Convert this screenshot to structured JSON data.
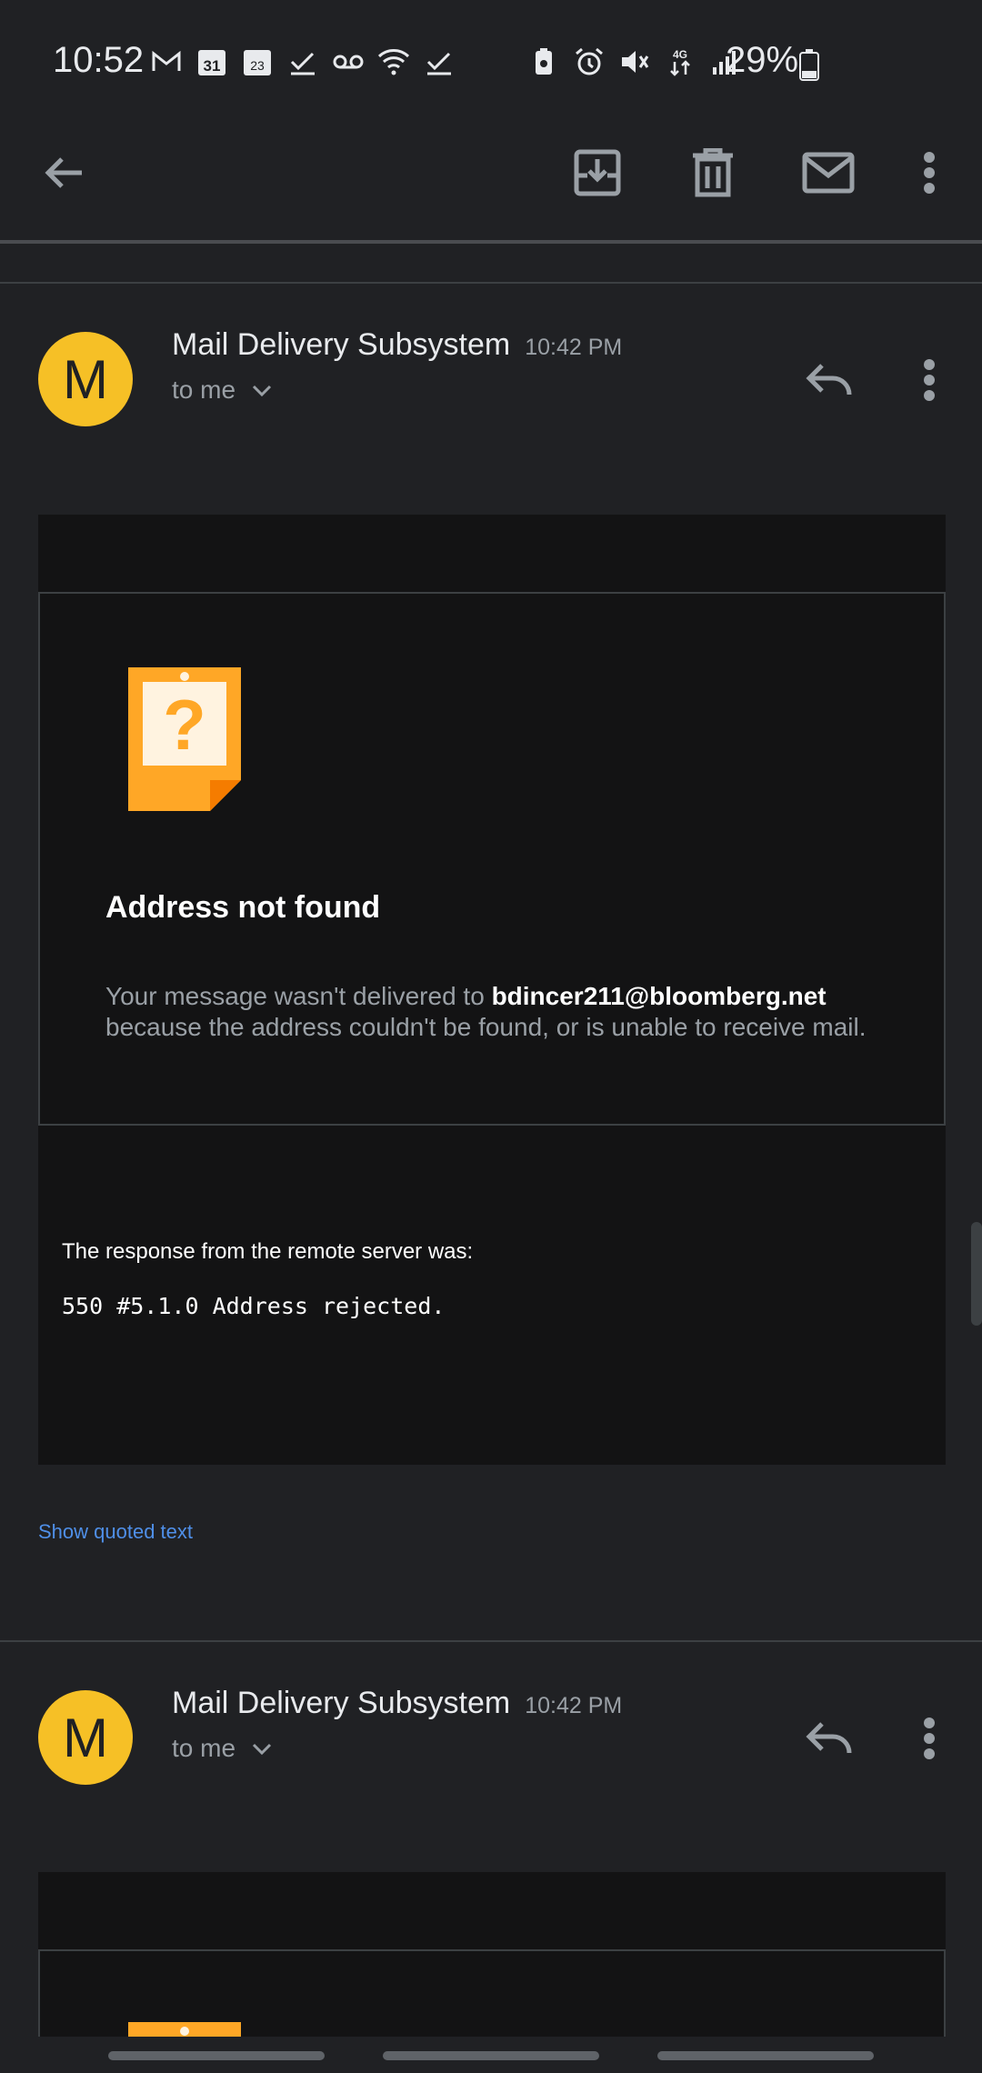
{
  "status_bar": {
    "time": "10:52",
    "battery_text": "29%",
    "left_icons": [
      "gmail-icon",
      "calendar-31-icon",
      "calendar-23-icon",
      "check-icon",
      "voicemail-icon",
      "wifi-icon",
      "check-icon"
    ],
    "right_icons": [
      "battery-saver-icon",
      "alarm-icon",
      "mute-icon",
      "data-4g-icon",
      "signal-icon"
    ]
  },
  "toolbar": {
    "icons": [
      "back-arrow-icon",
      "archive-icon",
      "trash-icon",
      "mark-unread-icon",
      "more-vert-icon"
    ]
  },
  "messages": [
    {
      "avatar_letter": "M",
      "sender": "Mail Delivery Subsystem",
      "time": "10:42 PM",
      "recipient": "to me",
      "card_title": "Address not found",
      "card_text_before": "Your message wasn't delivered to ",
      "card_email": "bdincer211@bloomberg.net",
      "card_text_after": "because the address couldn't be found, or is unable to receive mail.",
      "response_label": "The response from the remote server was:",
      "response_code": "550 #5.1.0 Address rejected.",
      "show_quoted": "Show quoted text"
    },
    {
      "avatar_letter": "M",
      "sender": "Mail Delivery Subsystem",
      "time": "10:42 PM",
      "recipient": "to me"
    }
  ],
  "colors": {
    "background": "#202124",
    "avatar": "#f6c026",
    "link": "#4f8fe8",
    "warning_icon": "#ffa726"
  }
}
